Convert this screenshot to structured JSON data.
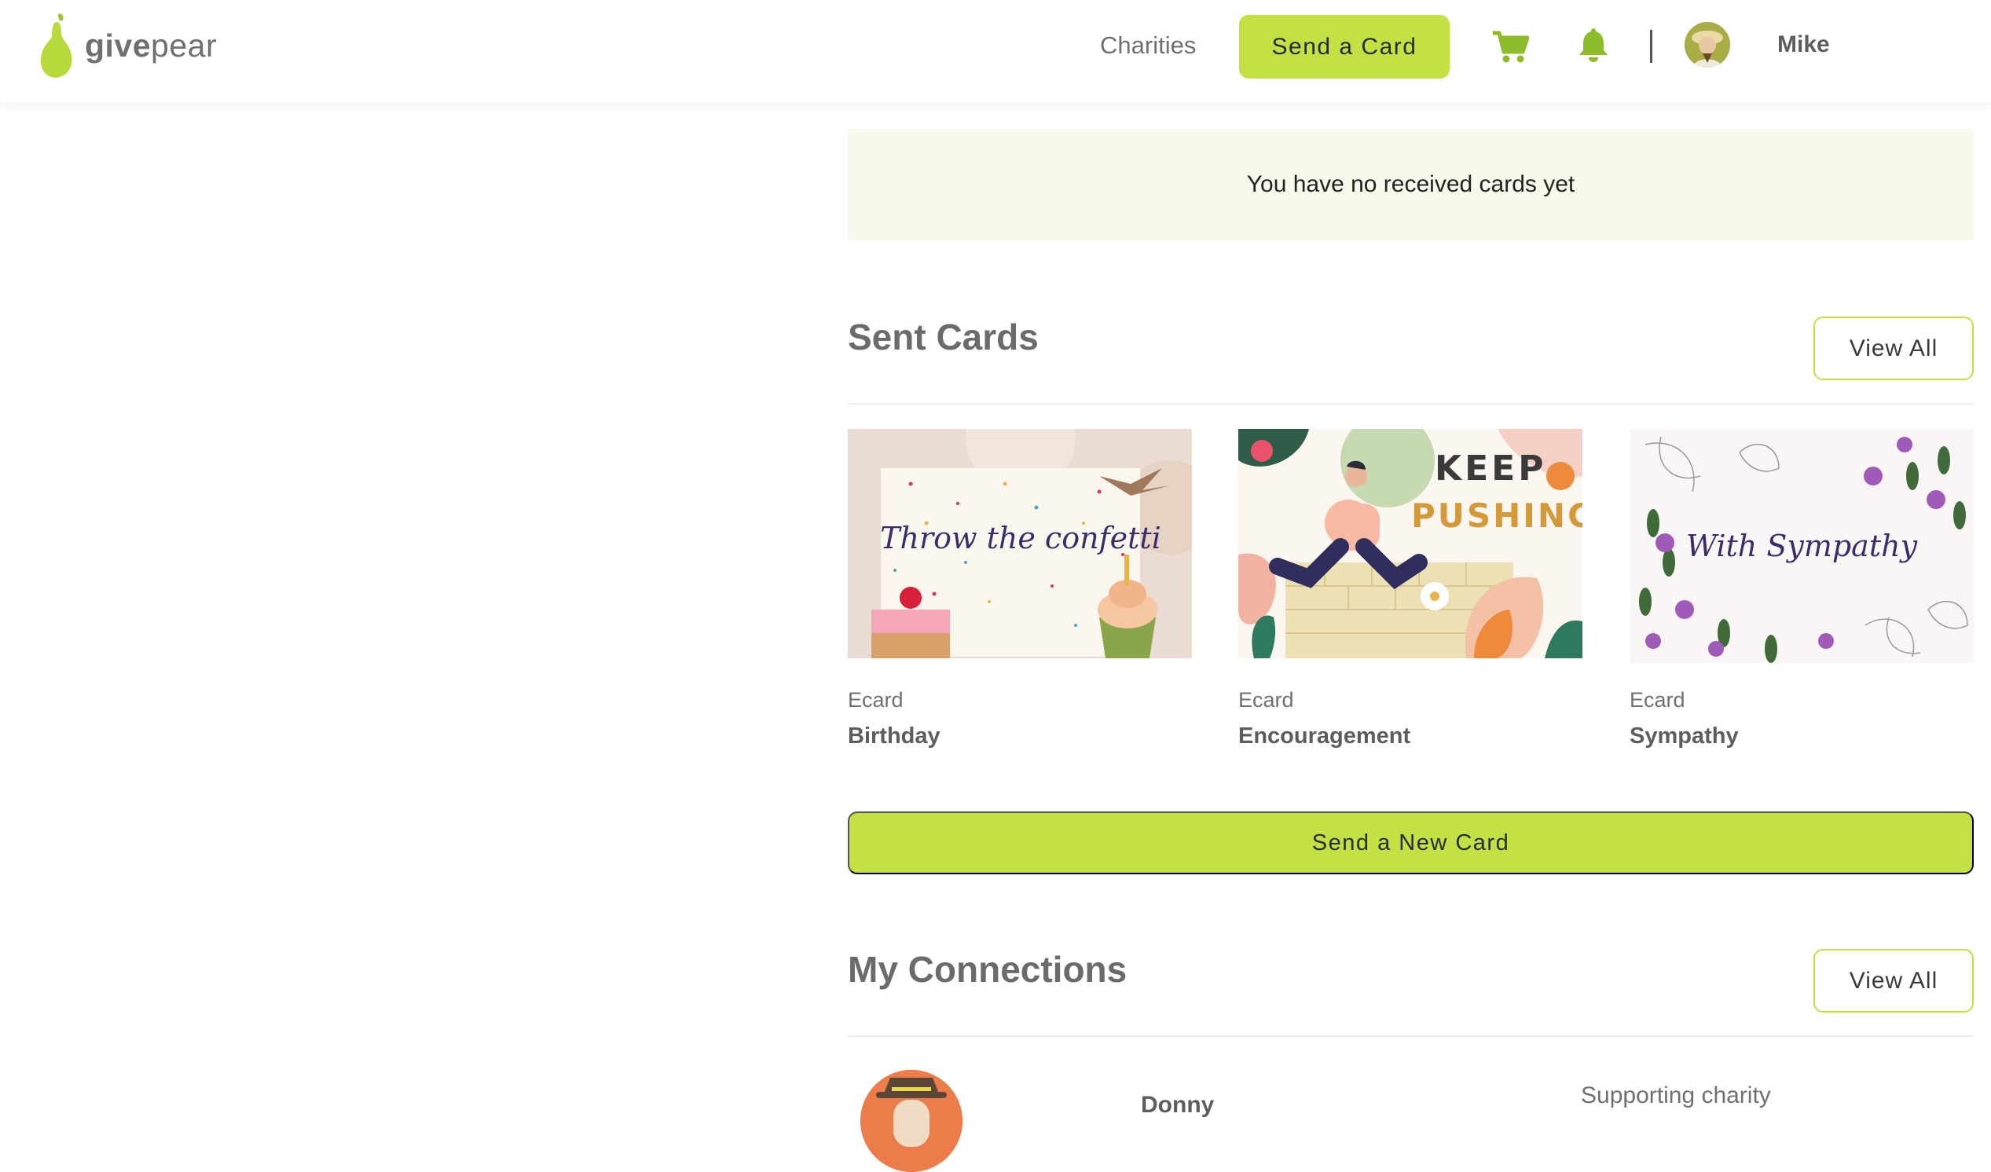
{
  "brand": {
    "name_part1": "give",
    "name_part2": "pear",
    "accent": "#c3e044"
  },
  "header": {
    "nav_charities": "Charities",
    "send_card_label": "Send a Card",
    "cart_icon": "shopping-cart-icon",
    "bell_icon": "bell-icon",
    "user_name": "Mike"
  },
  "received": {
    "empty_message": "You have no received cards yet"
  },
  "sent_cards": {
    "title": "Sent Cards",
    "view_all_label": "View All",
    "cards": [
      {
        "type": "Ecard",
        "name": "Birthday",
        "image_text": "Throw the confetti"
      },
      {
        "type": "Ecard",
        "name": "Encouragement",
        "image_text_1": "KEEP",
        "image_text_2": "PUSHING"
      },
      {
        "type": "Ecard",
        "name": "Sympathy",
        "image_text": "With Sympathy"
      }
    ],
    "new_card_label": "Send a New Card"
  },
  "connections": {
    "title": "My Connections",
    "view_all_label": "View All",
    "items": [
      {
        "name": "Donny",
        "charity_label": "Supporting charity"
      }
    ]
  }
}
